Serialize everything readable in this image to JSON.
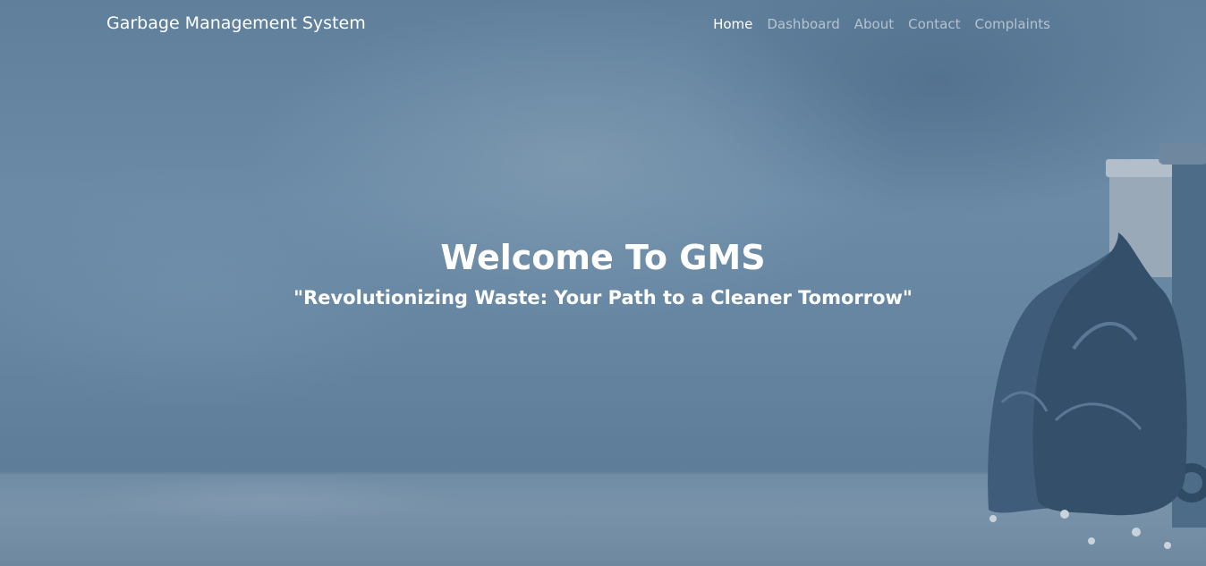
{
  "navbar": {
    "brand": "Garbage Management System",
    "links": [
      {
        "label": "Home",
        "active": true
      },
      {
        "label": "Dashboard",
        "active": false
      },
      {
        "label": "About",
        "active": false
      },
      {
        "label": "Contact",
        "active": false
      },
      {
        "label": "Complaints",
        "active": false
      }
    ]
  },
  "hero": {
    "title": "Welcome To GMS",
    "subtitle": "\"Revolutionizing Waste: Your Path to a Cleaner Tomorrow\"",
    "background": "garbage-bags-and-bins-image",
    "overlay_color": "#5f7f9b"
  }
}
